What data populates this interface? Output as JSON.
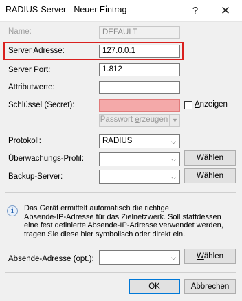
{
  "window": {
    "title": "RADIUS-Server - Neuer Eintrag",
    "help_glyph": "?",
    "close_glyph": "✕"
  },
  "form": {
    "name": {
      "label": "Name:",
      "value": "DEFAULT",
      "enabled": false
    },
    "server_address": {
      "label": "Server Adresse:",
      "value": "127.0.0.1",
      "highlighted_color": "#d9201e"
    },
    "server_port": {
      "label": "Server Port:",
      "value": "1.812"
    },
    "attribute_values": {
      "label": "Attributwerte:",
      "value": ""
    },
    "secret": {
      "label": "Schlüssel (Secret):",
      "value": "",
      "error_color": "#f4a9a9"
    },
    "show_password": {
      "label_prefix": "",
      "label_underlined": "A",
      "label_rest": "nzeigen",
      "checked": false
    },
    "generate_password": {
      "label_prefix": "Passwort ",
      "label_underlined": "e",
      "label_rest": "rzeugen",
      "enabled": false
    },
    "protocol": {
      "label": "Protokoll:",
      "value": "RADIUS"
    },
    "monitoring_profile": {
      "label": "Überwachungs-Profil:",
      "value": ""
    },
    "backup_server": {
      "label": "Backup-Server:",
      "value": ""
    },
    "select_button": {
      "label_underlined": "W",
      "label_rest": "ählen"
    }
  },
  "info": {
    "icon": "info-icon",
    "lines": [
      "Das Gerät ermittelt automatisch die richtige",
      "Absende-IP-Adresse für das Zielnetzwerk. Soll stattdessen",
      "eine fest definierte Absende-IP-Adresse verwendet werden,",
      "tragen Sie diese hier symbolisch oder direkt ein."
    ]
  },
  "source_address": {
    "label": "Absende-Adresse (opt.):",
    "value": ""
  },
  "buttons": {
    "ok": "OK",
    "cancel": "Abbrechen"
  }
}
